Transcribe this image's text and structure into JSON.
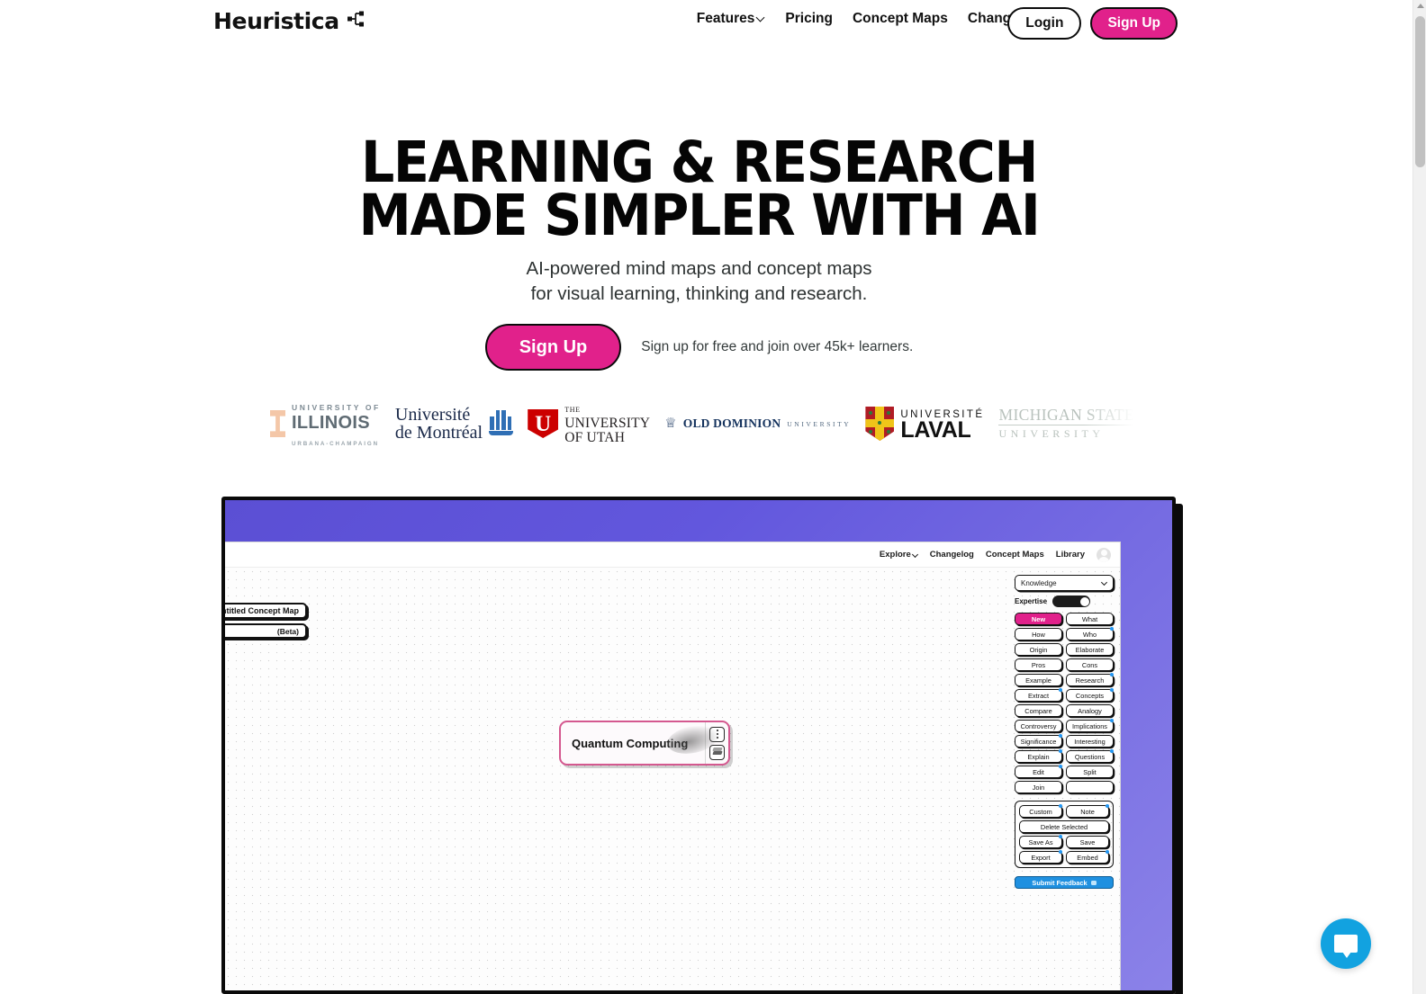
{
  "brand": {
    "name": "Heuristica",
    "glyph_icon": "node-graph-icon"
  },
  "nav": {
    "links": [
      {
        "label": "Features",
        "has_chevron": true
      },
      {
        "label": "Pricing",
        "has_chevron": false
      },
      {
        "label": "Concept Maps",
        "has_chevron": false
      },
      {
        "label": "Changelog",
        "has_chevron": false
      }
    ],
    "login_label": "Login",
    "signup_label": "Sign Up"
  },
  "hero": {
    "heading_line1": "LEARNING & RESEARCH",
    "heading_line2": "MADE SIMPLER WITH AI",
    "sub_line1": "AI-powered mind maps and concept maps",
    "sub_line2": "for visual learning, thinking and research.",
    "cta_label": "Sign Up",
    "cta_note": "Sign up for free and join over 45k+ learners."
  },
  "logos": [
    {
      "name": "University of Illinois Urbana-Champaign",
      "line1": "UNIVERSITY OF",
      "line2": "ILLINOIS",
      "line3": "URBANA-CHAMPAIGN"
    },
    {
      "name": "Universite de Montreal",
      "line1": "Université",
      "line2": "de Montréal"
    },
    {
      "name": "The University of Utah",
      "mark": "U",
      "line1": "THE",
      "line2": "UNIVERSITY",
      "line3": "OF UTAH"
    },
    {
      "name": "Old Dominion University",
      "line1": "OLD DOMINION",
      "line2": "UNIVERSITY"
    },
    {
      "name": "Universite Laval",
      "line1": "UNIVERSITÉ",
      "line2": "LAVAL"
    },
    {
      "name": "Michigan State University",
      "line1": "MICHIGAN STATE",
      "line2": "UNIVERSITY"
    }
  ],
  "app": {
    "topnav": [
      {
        "label": "Explore",
        "has_chevron": true
      },
      {
        "label": "Changelog",
        "has_chevron": false
      },
      {
        "label": "Concept Maps",
        "has_chevron": false
      },
      {
        "label": "Library",
        "has_chevron": false
      }
    ],
    "map_title": "Untitled Concept Map",
    "map_beta": "(Beta)",
    "node_label": "Quantum Computing",
    "panel": {
      "select_value": "Knowledge",
      "expertise_label": "Expertise",
      "expertise_on": true,
      "buttons": [
        {
          "label": "New",
          "active": true,
          "badge": false
        },
        {
          "label": "What",
          "active": false,
          "badge": false
        },
        {
          "label": "How",
          "active": false,
          "badge": false
        },
        {
          "label": "Who",
          "active": false,
          "badge": true
        },
        {
          "label": "Origin",
          "active": false,
          "badge": false
        },
        {
          "label": "Elaborate",
          "active": false,
          "badge": false
        },
        {
          "label": "Pros",
          "active": false,
          "badge": false
        },
        {
          "label": "Cons",
          "active": false,
          "badge": false
        },
        {
          "label": "Example",
          "active": false,
          "badge": false
        },
        {
          "label": "Research",
          "active": false,
          "badge": true
        },
        {
          "label": "Extract",
          "active": false,
          "badge": true
        },
        {
          "label": "Concepts",
          "active": false,
          "badge": true
        },
        {
          "label": "Compare",
          "active": false,
          "badge": false
        },
        {
          "label": "Analogy",
          "active": false,
          "badge": false
        },
        {
          "label": "Controversy",
          "active": false,
          "badge": false
        },
        {
          "label": "Implications",
          "active": false,
          "badge": true
        },
        {
          "label": "Significance",
          "active": false,
          "badge": true
        },
        {
          "label": "Interesting",
          "active": false,
          "badge": false
        },
        {
          "label": "Explain",
          "active": false,
          "badge": true
        },
        {
          "label": "Questions",
          "active": false,
          "badge": true
        },
        {
          "label": "Edit",
          "active": false,
          "badge": true
        },
        {
          "label": "Split",
          "active": false,
          "badge": false
        },
        {
          "label": "Join",
          "active": false,
          "badge": false
        },
        {
          "label": "",
          "active": false,
          "badge": false
        }
      ],
      "grouped": [
        {
          "label": "Custom",
          "badge": true,
          "wide": false
        },
        {
          "label": "Note",
          "badge": true,
          "wide": false
        },
        {
          "label": "Delete Selected",
          "badge": false,
          "wide": true
        },
        {
          "label": "Save As",
          "badge": true,
          "wide": false
        },
        {
          "label": "Save",
          "badge": false,
          "wide": false
        },
        {
          "label": "Export",
          "badge": true,
          "wide": false
        },
        {
          "label": "Embed",
          "badge": true,
          "wide": false
        }
      ],
      "submit_feedback_label": "Submit Feedback"
    }
  },
  "support": {
    "icon": "chat-bubble-icon"
  },
  "colors": {
    "accent_pink": "#e1218b",
    "frame_purple": "#5b4fd4",
    "feedback_blue": "#1f90e0",
    "support_blue": "#12a2e0",
    "badge_blue": "#2196f3"
  }
}
